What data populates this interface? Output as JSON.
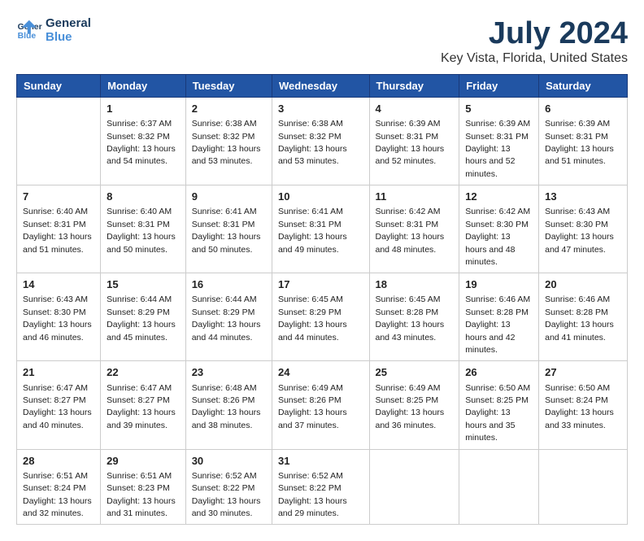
{
  "header": {
    "logo_line1": "General",
    "logo_line2": "Blue",
    "title": "July 2024",
    "subtitle": "Key Vista, Florida, United States"
  },
  "weekdays": [
    "Sunday",
    "Monday",
    "Tuesday",
    "Wednesday",
    "Thursday",
    "Friday",
    "Saturday"
  ],
  "weeks": [
    [
      {
        "day": "",
        "sunrise": "",
        "sunset": "",
        "daylight": ""
      },
      {
        "day": "1",
        "sunrise": "6:37 AM",
        "sunset": "8:32 PM",
        "daylight": "13 hours and 54 minutes."
      },
      {
        "day": "2",
        "sunrise": "6:38 AM",
        "sunset": "8:32 PM",
        "daylight": "13 hours and 53 minutes."
      },
      {
        "day": "3",
        "sunrise": "6:38 AM",
        "sunset": "8:32 PM",
        "daylight": "13 hours and 53 minutes."
      },
      {
        "day": "4",
        "sunrise": "6:39 AM",
        "sunset": "8:31 PM",
        "daylight": "13 hours and 52 minutes."
      },
      {
        "day": "5",
        "sunrise": "6:39 AM",
        "sunset": "8:31 PM",
        "daylight": "13 hours and 52 minutes."
      },
      {
        "day": "6",
        "sunrise": "6:39 AM",
        "sunset": "8:31 PM",
        "daylight": "13 hours and 51 minutes."
      }
    ],
    [
      {
        "day": "7",
        "sunrise": "6:40 AM",
        "sunset": "8:31 PM",
        "daylight": "13 hours and 51 minutes."
      },
      {
        "day": "8",
        "sunrise": "6:40 AM",
        "sunset": "8:31 PM",
        "daylight": "13 hours and 50 minutes."
      },
      {
        "day": "9",
        "sunrise": "6:41 AM",
        "sunset": "8:31 PM",
        "daylight": "13 hours and 50 minutes."
      },
      {
        "day": "10",
        "sunrise": "6:41 AM",
        "sunset": "8:31 PM",
        "daylight": "13 hours and 49 minutes."
      },
      {
        "day": "11",
        "sunrise": "6:42 AM",
        "sunset": "8:31 PM",
        "daylight": "13 hours and 48 minutes."
      },
      {
        "day": "12",
        "sunrise": "6:42 AM",
        "sunset": "8:30 PM",
        "daylight": "13 hours and 48 minutes."
      },
      {
        "day": "13",
        "sunrise": "6:43 AM",
        "sunset": "8:30 PM",
        "daylight": "13 hours and 47 minutes."
      }
    ],
    [
      {
        "day": "14",
        "sunrise": "6:43 AM",
        "sunset": "8:30 PM",
        "daylight": "13 hours and 46 minutes."
      },
      {
        "day": "15",
        "sunrise": "6:44 AM",
        "sunset": "8:29 PM",
        "daylight": "13 hours and 45 minutes."
      },
      {
        "day": "16",
        "sunrise": "6:44 AM",
        "sunset": "8:29 PM",
        "daylight": "13 hours and 44 minutes."
      },
      {
        "day": "17",
        "sunrise": "6:45 AM",
        "sunset": "8:29 PM",
        "daylight": "13 hours and 44 minutes."
      },
      {
        "day": "18",
        "sunrise": "6:45 AM",
        "sunset": "8:28 PM",
        "daylight": "13 hours and 43 minutes."
      },
      {
        "day": "19",
        "sunrise": "6:46 AM",
        "sunset": "8:28 PM",
        "daylight": "13 hours and 42 minutes."
      },
      {
        "day": "20",
        "sunrise": "6:46 AM",
        "sunset": "8:28 PM",
        "daylight": "13 hours and 41 minutes."
      }
    ],
    [
      {
        "day": "21",
        "sunrise": "6:47 AM",
        "sunset": "8:27 PM",
        "daylight": "13 hours and 40 minutes."
      },
      {
        "day": "22",
        "sunrise": "6:47 AM",
        "sunset": "8:27 PM",
        "daylight": "13 hours and 39 minutes."
      },
      {
        "day": "23",
        "sunrise": "6:48 AM",
        "sunset": "8:26 PM",
        "daylight": "13 hours and 38 minutes."
      },
      {
        "day": "24",
        "sunrise": "6:49 AM",
        "sunset": "8:26 PM",
        "daylight": "13 hours and 37 minutes."
      },
      {
        "day": "25",
        "sunrise": "6:49 AM",
        "sunset": "8:25 PM",
        "daylight": "13 hours and 36 minutes."
      },
      {
        "day": "26",
        "sunrise": "6:50 AM",
        "sunset": "8:25 PM",
        "daylight": "13 hours and 35 minutes."
      },
      {
        "day": "27",
        "sunrise": "6:50 AM",
        "sunset": "8:24 PM",
        "daylight": "13 hours and 33 minutes."
      }
    ],
    [
      {
        "day": "28",
        "sunrise": "6:51 AM",
        "sunset": "8:24 PM",
        "daylight": "13 hours and 32 minutes."
      },
      {
        "day": "29",
        "sunrise": "6:51 AM",
        "sunset": "8:23 PM",
        "daylight": "13 hours and 31 minutes."
      },
      {
        "day": "30",
        "sunrise": "6:52 AM",
        "sunset": "8:22 PM",
        "daylight": "13 hours and 30 minutes."
      },
      {
        "day": "31",
        "sunrise": "6:52 AM",
        "sunset": "8:22 PM",
        "daylight": "13 hours and 29 minutes."
      },
      {
        "day": "",
        "sunrise": "",
        "sunset": "",
        "daylight": ""
      },
      {
        "day": "",
        "sunrise": "",
        "sunset": "",
        "daylight": ""
      },
      {
        "day": "",
        "sunrise": "",
        "sunset": "",
        "daylight": ""
      }
    ]
  ]
}
